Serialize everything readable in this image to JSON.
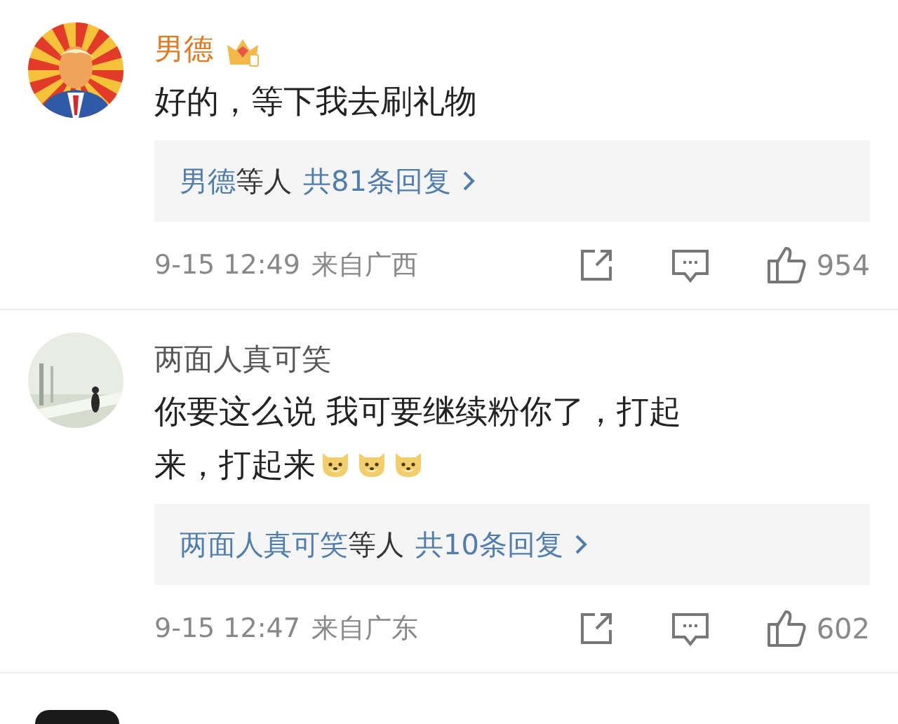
{
  "comments": [
    {
      "avatar": {
        "kind": "sunburst"
      },
      "name": "男德",
      "vip": true,
      "text": "好的，等下我去刷礼物",
      "reply": {
        "names": "男德",
        "suffix": "等人",
        "count": "共81条回复"
      },
      "time": "9-15 12:49",
      "location": "来自广西",
      "likes": "954"
    },
    {
      "name": "两面人真可笑",
      "vip": false,
      "text": "你要这么说 我可要继续粉你了，打起来，打起来",
      "emojis": [
        {
          "kind": "doge"
        },
        {
          "kind": "doge"
        },
        {
          "kind": "doge"
        }
      ],
      "reply": {
        "names": "两面人真可笑",
        "suffix": "等人",
        "count": "共10条回复"
      },
      "time": "9-15 12:47",
      "location": "来自广东",
      "likes": "602"
    }
  ],
  "next_comment_peek": true
}
